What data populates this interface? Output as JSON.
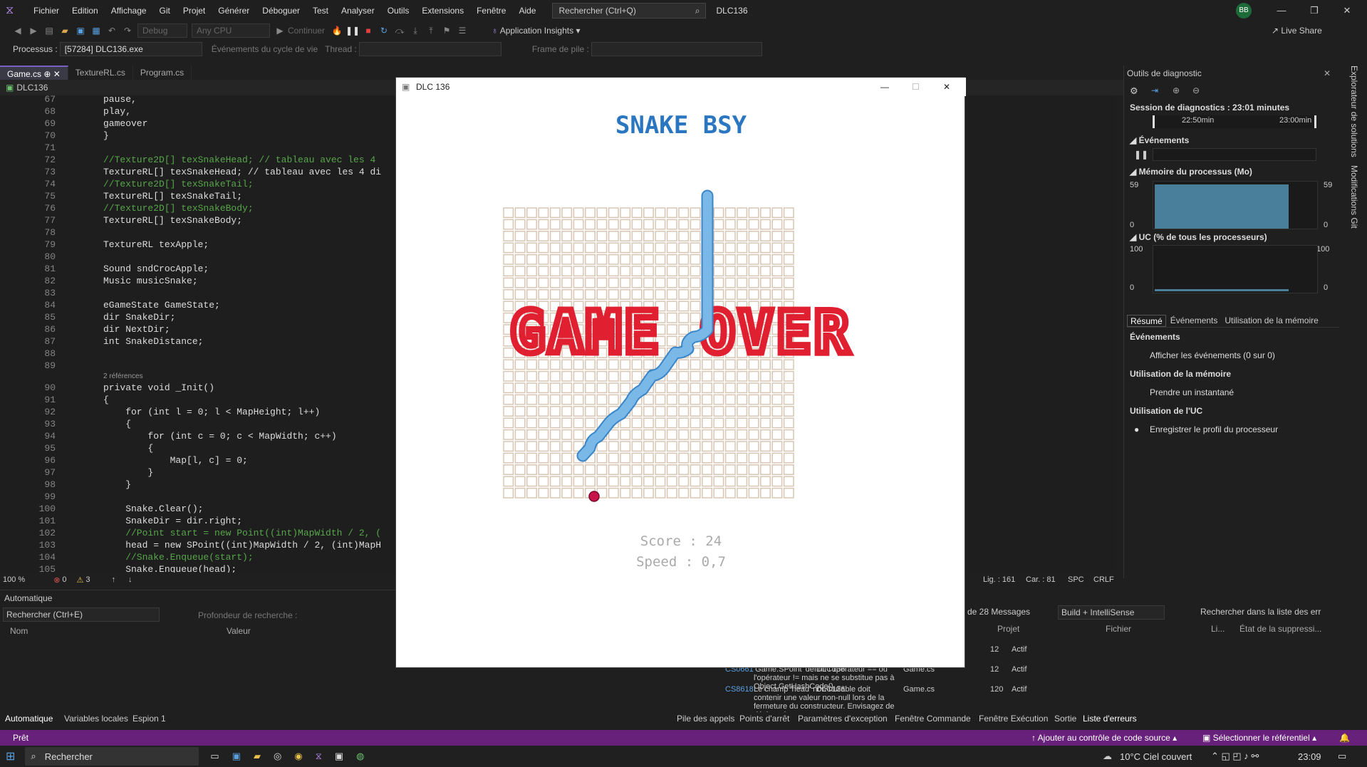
{
  "menubar": {
    "items": [
      "Fichier",
      "Edition",
      "Affichage",
      "Git",
      "Projet",
      "Générer",
      "Déboguer",
      "Test",
      "Analyser",
      "Outils",
      "Extensions",
      "Fenêtre",
      "Aide"
    ],
    "search_placeholder": "Rechercher (Ctrl+Q)",
    "solution": "DLC136",
    "avatar_initials": "BB"
  },
  "toolbar": {
    "config": "Debug",
    "platform": "Any CPU",
    "continue": "Continuer",
    "app_insights": "Application Insights",
    "live_share": "Live Share"
  },
  "toolbar2": {
    "process_label": "Processus :",
    "process_value": "[57284] DLC136.exe",
    "lifecycle": "Événements du cycle de vie",
    "thread_label": "Thread :",
    "frame_label": "Frame de pile :"
  },
  "tabs": [
    "Game.cs",
    "TextureRL.cs",
    "Program.cs"
  ],
  "navbar": {
    "project": "DLC136"
  },
  "code": [
    {
      "n": "67",
      "t": "pause,"
    },
    {
      "n": "68",
      "t": "play,"
    },
    {
      "n": "69",
      "t": "gameover"
    },
    {
      "n": "70",
      "t": "}"
    },
    {
      "n": "71",
      "t": ""
    },
    {
      "n": "72",
      "t": "//Texture2D[] texSnakeHead; // tableau avec les 4"
    },
    {
      "n": "73",
      "t": "TextureRL[] texSnakeHead; // tableau avec les 4 di"
    },
    {
      "n": "74",
      "t": "//Texture2D[] texSnakeTail;"
    },
    {
      "n": "75",
      "t": "TextureRL[] texSnakeTail;"
    },
    {
      "n": "76",
      "t": "//Texture2D[] texSnakeBody;"
    },
    {
      "n": "77",
      "t": "TextureRL[] texSnakeBody;"
    },
    {
      "n": "78",
      "t": ""
    },
    {
      "n": "79",
      "t": "TextureRL texApple;"
    },
    {
      "n": "80",
      "t": ""
    },
    {
      "n": "81",
      "t": "Sound sndCrocApple;"
    },
    {
      "n": "82",
      "t": "Music musicSnake;"
    },
    {
      "n": "83",
      "t": ""
    },
    {
      "n": "84",
      "t": "eGameState GameState;"
    },
    {
      "n": "85",
      "t": "dir SnakeDir;"
    },
    {
      "n": "86",
      "t": "dir NextDir;"
    },
    {
      "n": "87",
      "t": "int SnakeDistance;"
    },
    {
      "n": "88",
      "t": ""
    },
    {
      "n": "89",
      "t": ""
    },
    {
      "n": "90",
      "t": "private void _Init()"
    },
    {
      "n": "91",
      "t": "{"
    },
    {
      "n": "92",
      "t": "    for (int l = 0; l < MapHeight; l++)"
    },
    {
      "n": "93",
      "t": "    {"
    },
    {
      "n": "94",
      "t": "        for (int c = 0; c < MapWidth; c++)"
    },
    {
      "n": "95",
      "t": "        {"
    },
    {
      "n": "96",
      "t": "            Map[l, c] = 0;"
    },
    {
      "n": "97",
      "t": "        }"
    },
    {
      "n": "98",
      "t": "    }"
    },
    {
      "n": "99",
      "t": ""
    },
    {
      "n": "100",
      "t": "    Snake.Clear();"
    },
    {
      "n": "101",
      "t": "    SnakeDir = dir.right;"
    },
    {
      "n": "102",
      "t": "    //Point start = new Point((int)MapWidth / 2, ("
    },
    {
      "n": "103",
      "t": "    head = new SPoint((int)MapWidth / 2, (int)MapH"
    },
    {
      "n": "104",
      "t": "    //Snake.Enqueue(start);"
    },
    {
      "n": "105",
      "t": "    Snake.Enqueue(head);"
    }
  ],
  "refs_label": "2 références",
  "editor_status": {
    "zoom": "100 %",
    "errors": "0",
    "warnings": "3",
    "line": "Lig. : 161",
    "col": "Car. : 81",
    "spc": "SPC",
    "eol": "CRLF"
  },
  "diag": {
    "title": "Outils de diagnostic",
    "session": "Session de diagnostics : 23:01 minutes",
    "t1": "22:50min",
    "t2": "23:00min",
    "events": "Événements",
    "memory": "Mémoire du processus (Mo)",
    "mem_max": "59",
    "mem_min": "0",
    "cpu": "UC (% de tous les processeurs)",
    "cpu_max": "100",
    "cpu_min": "0",
    "tabs": [
      "Résumé",
      "Événements",
      "Utilisation de la mémoire"
    ],
    "sec_events": "Événements",
    "show_events": "Afficher les événements (0 sur 0)",
    "sec_memory": "Utilisation de la mémoire",
    "snapshot": "Prendre un instantané",
    "sec_cpu": "Utilisation de l'UC",
    "record_cpu": "Enregistrer le profil du processeur",
    "side_tabs": [
      "Explorateur de solutions",
      "Modifications Git"
    ]
  },
  "autos": {
    "title": "Automatique",
    "search": "Rechercher (Ctrl+E)",
    "depth": "Profondeur de recherche :",
    "col_name": "Nom",
    "col_value": "Valeur",
    "tabs": [
      "Automatique",
      "Variables locales",
      "Espion 1"
    ]
  },
  "errors": {
    "messages": "de 28 Messages",
    "build": "Build + IntelliSense",
    "search": "Rechercher dans la liste des err",
    "headers": [
      "Projet",
      "Fichier",
      "Li...",
      "État de la suppressi..."
    ],
    "rows": [
      {
        "code": "",
        "desc": "... ne se",
        "proj": "DLC136",
        "file": "Game.cs",
        "line": "12",
        "state": "Actif"
      },
      {
        "code": "CS0661",
        "desc": "'Game.SPoint' définit l'opérateur == ou l'opérateur != mais ne se substitue pas à Object.GetHashCode()",
        "proj": "DLC136",
        "file": "Game.cs",
        "line": "12",
        "state": "Actif"
      },
      {
        "code": "CS8618",
        "desc": "Le champ 'head' non-nullable doit contenir une valeur non-null lors de la fermeture du constructeur. Envisagez de déclarer le",
        "proj": "DLC136",
        "file": "Game.cs",
        "line": "120",
        "state": "Actif"
      }
    ],
    "tabs": [
      "Pile des appels",
      "Points d'arrêt",
      "Paramètres d'exception",
      "Fenêtre Commande",
      "Fenêtre Exécution",
      "Sortie",
      "Liste d'erreurs"
    ]
  },
  "status": {
    "ready": "Prêt",
    "source_control": "Ajouter au contrôle de code source",
    "repo": "Sélectionner le référentiel"
  },
  "taskbar": {
    "search": "Rechercher",
    "weather": "10°C Ciel couvert",
    "time": "23:09"
  },
  "game": {
    "window_title": "DLC 136",
    "logo": "SNAKE BSY",
    "gameover": "GAME OVER",
    "score": "Score : 24",
    "speed": "Speed : 0,7",
    "colors": {
      "grid": "#d8c6b4",
      "snake": "#7ab8e8",
      "snake_outline": "#3a86c8",
      "gameover": "#e02030",
      "apple": "#c8144a",
      "logo": "#2b76c0"
    }
  }
}
